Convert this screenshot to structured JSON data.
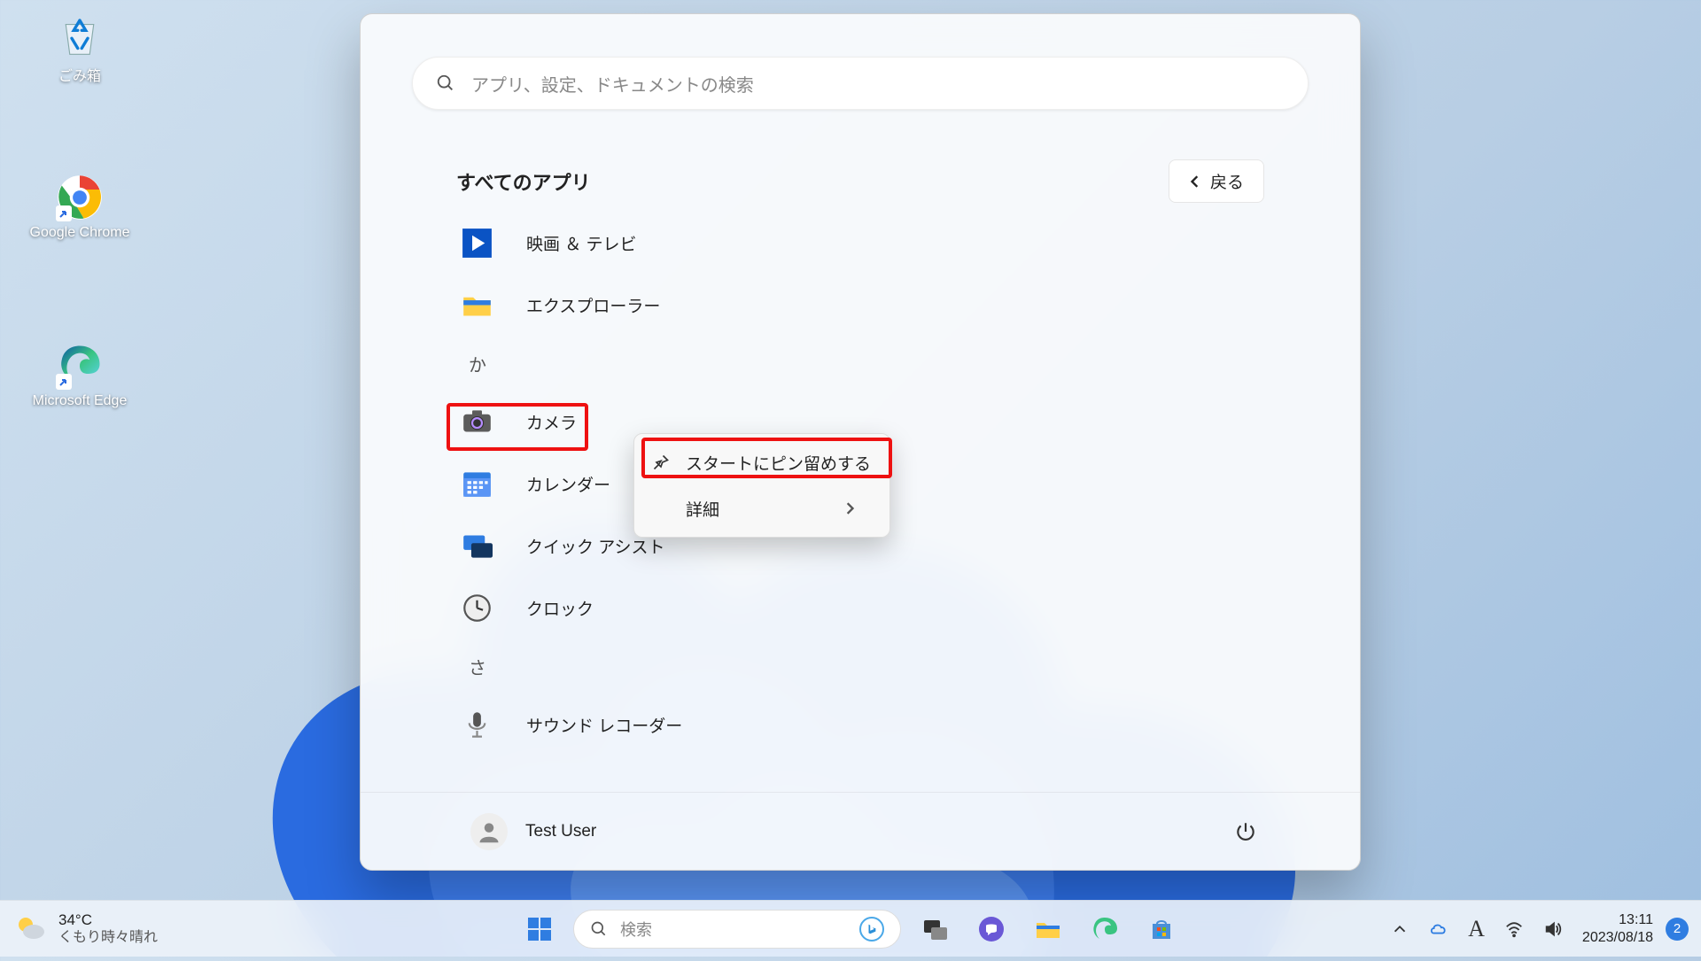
{
  "desktop": {
    "recycle": "ごみ箱",
    "chrome": "Google Chrome",
    "edge": "Microsoft Edge"
  },
  "start": {
    "search_placeholder": "アプリ、設定、ドキュメントの検索",
    "all_apps_title": "すべてのアプリ",
    "back_label": "戻る",
    "letter_ka": "か",
    "letter_sa": "さ",
    "apps": {
      "movies_tv": "映画 ＆ テレビ",
      "explorer": "エクスプローラー",
      "camera": "カメラ",
      "calendar": "カレンダー",
      "quick_assist": "クイック アシスト",
      "clock": "クロック",
      "sound_recorder": "サウンド レコーダー"
    },
    "user_name": "Test User"
  },
  "context_menu": {
    "pin_to_start": "スタートにピン留めする",
    "details": "詳細"
  },
  "taskbar": {
    "temperature": "34°C",
    "weather_condition": "くもり時々晴れ",
    "search_placeholder": "検索",
    "time": "13:11",
    "date": "2023/08/18",
    "notification_count": "2"
  }
}
